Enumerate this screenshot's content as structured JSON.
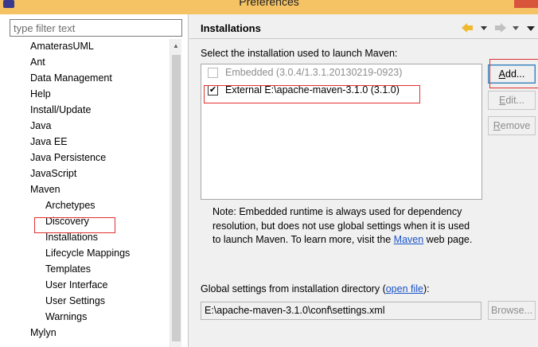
{
  "window": {
    "title": "Preferences"
  },
  "filter": {
    "placeholder": "type filter text",
    "value": ""
  },
  "tree": [
    {
      "label": "AmaterasUML",
      "level": 1
    },
    {
      "label": "Ant",
      "level": 1
    },
    {
      "label": "Data Management",
      "level": 1
    },
    {
      "label": "Help",
      "level": 1
    },
    {
      "label": "Install/Update",
      "level": 1
    },
    {
      "label": "Java",
      "level": 1
    },
    {
      "label": "Java EE",
      "level": 1
    },
    {
      "label": "Java Persistence",
      "level": 1
    },
    {
      "label": "JavaScript",
      "level": 1
    },
    {
      "label": "Maven",
      "level": 1
    },
    {
      "label": "Archetypes",
      "level": 2
    },
    {
      "label": "Discovery",
      "level": 2
    },
    {
      "label": "Installations",
      "level": 2,
      "selected": true
    },
    {
      "label": "Lifecycle Mappings",
      "level": 2
    },
    {
      "label": "Templates",
      "level": 2
    },
    {
      "label": "User Interface",
      "level": 2
    },
    {
      "label": "User Settings",
      "level": 2
    },
    {
      "label": "Warnings",
      "level": 2
    },
    {
      "label": "Mylyn",
      "level": 1
    }
  ],
  "page": {
    "title": "Installations",
    "select_label": "Select the installation used to launch Maven:",
    "installations": [
      {
        "label": "Embedded (3.0.4/1.3.1.20130219-0923)",
        "checked": false,
        "enabled": false
      },
      {
        "label": "External E:\\apache-maven-3.1.0 (3.1.0)",
        "checked": true,
        "enabled": true
      }
    ],
    "buttons": {
      "add_pre": "",
      "add_u": "A",
      "add_post": "dd...",
      "edit_pre": "",
      "edit_u": "E",
      "edit_post": "dit...",
      "remove_pre": "",
      "remove_u": "R",
      "remove_post": "emove",
      "browse_label": "Browse..."
    },
    "note": {
      "text_before": "Note: Embedded runtime is always used for dependency resolution, but does not use global settings when it is used to launch Maven. To learn more, visit the ",
      "link": "Maven",
      "text_after": " web page."
    },
    "global": {
      "label_before": "Global settings from installation directory (",
      "link": "open file",
      "label_after": "):",
      "value": "E:\\apache-maven-3.1.0\\conf\\settings.xml"
    }
  },
  "colors": {
    "highlight_border": "#e03030",
    "link": "#1a54c8",
    "titlebar": "#f5c264"
  }
}
